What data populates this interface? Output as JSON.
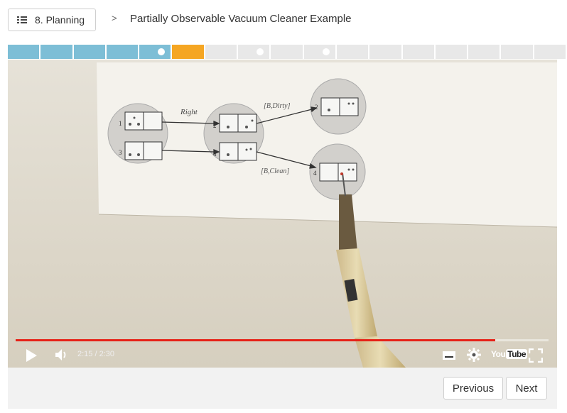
{
  "header": {
    "lesson_label": "8. Planning",
    "separator": ">",
    "title": "Partially Observable Vacuum Cleaner Example"
  },
  "progress": {
    "segments": [
      "done",
      "done",
      "done",
      "done",
      "done-dot",
      "current",
      "todo",
      "todo-dot",
      "todo",
      "todo-dot",
      "todo",
      "todo",
      "todo",
      "todo",
      "todo",
      "todo",
      "todo"
    ],
    "colors": {
      "done": "#7dbed6",
      "current": "#f5a623",
      "todo": "#e8e8e8"
    }
  },
  "video": {
    "diagram": {
      "action_label": "Right",
      "percept_dirty": "[B,Dirty]",
      "percept_clean": "[B,Clean]",
      "state_1": "1",
      "state_3": "3",
      "state_2a": "2",
      "state_4a": "4",
      "state_2b": "2",
      "state_4b": "4"
    },
    "time_display": "2:15 / 2:30",
    "progress_fraction": 0.9,
    "youtube_label_a": "You",
    "youtube_label_b": "Tube"
  },
  "footer": {
    "previous_label": "Previous",
    "next_label": "Next"
  }
}
